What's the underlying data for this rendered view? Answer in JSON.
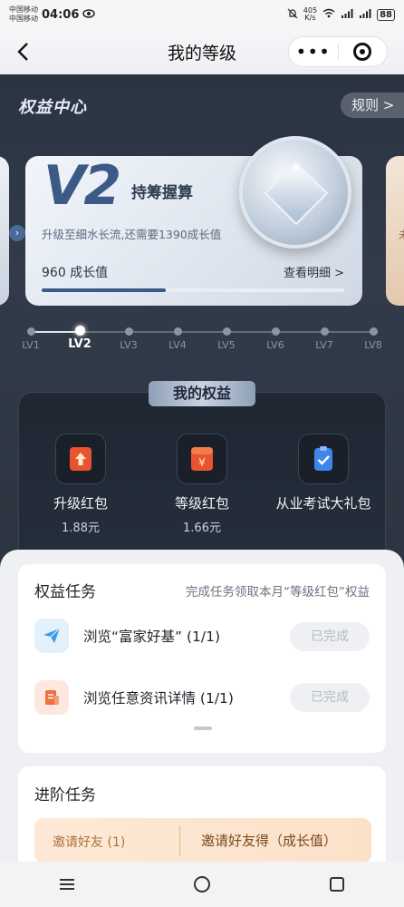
{
  "status_bar": {
    "carrier_1": "中国移动",
    "carrier_2": "中国移动",
    "time": "04:06",
    "net_speed_value": "405",
    "net_speed_unit": "K/s",
    "battery": "88"
  },
  "nav": {
    "title": "我的等级",
    "more_label": "•••"
  },
  "header": {
    "center_title": "权益中心",
    "rules_label": "规则 >"
  },
  "level_card": {
    "level": "V2",
    "level_name": "持筹握算",
    "upgrade_tip": "升级至细水长流,还需要1390成长值",
    "growth_value": "960 成长值",
    "detail_link": "查看明细 >",
    "progress": 0.41
  },
  "side_card_right_text": "未",
  "levels": [
    {
      "label": "LV1",
      "current": false
    },
    {
      "label": "LV2",
      "current": true
    },
    {
      "label": "LV3",
      "current": false
    },
    {
      "label": "LV4",
      "current": false
    },
    {
      "label": "LV5",
      "current": false
    },
    {
      "label": "LV6",
      "current": false
    },
    {
      "label": "LV7",
      "current": false
    },
    {
      "label": "LV8",
      "current": false
    }
  ],
  "benefits": {
    "title": "我的权益",
    "items": [
      {
        "name": "升级红包",
        "amount": "1.88元",
        "icon": "red-envelope-up-icon"
      },
      {
        "name": "等级红包",
        "amount": "1.66元",
        "icon": "red-envelope-yuan-icon"
      },
      {
        "name": "从业考试大礼包",
        "amount": "",
        "icon": "exam-clipboard-icon"
      }
    ]
  },
  "tasks": {
    "title": "权益任务",
    "desc": "完成任务领取本月“等级红包”权益",
    "items": [
      {
        "text": "浏览“富家好基” (1/1)",
        "status": "已完成",
        "icon": "paper-plane-icon"
      },
      {
        "text": "浏览任意资讯详情 (1/1)",
        "status": "已完成",
        "icon": "document-icon"
      }
    ]
  },
  "advanced": {
    "title": "进阶任务",
    "invite_left": "邀请好友 (1)",
    "invite_right": "邀请好友得（成长值）"
  },
  "colors": {
    "accent": "#3d5a86",
    "hero_bg": "#2b3442",
    "invite_bg": "#fde9d6"
  }
}
